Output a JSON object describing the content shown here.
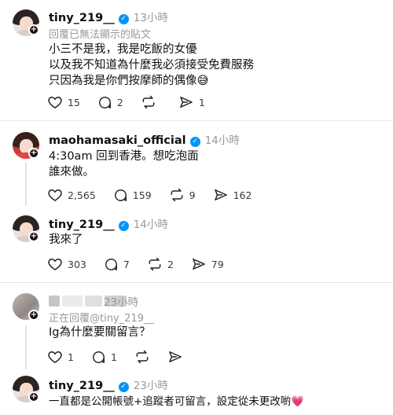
{
  "posts": [
    {
      "username": "tiny_219__",
      "verified": true,
      "time": "13小時",
      "subtext": "回覆已無法顯示的貼文",
      "text": "小三不是我，我是吃飯的女優\n以及我不知道為什麼我必須接受免費服務\n只因為我是你們按摩師的偶像😅",
      "likes": "15",
      "comments": "2",
      "reposts": "",
      "shares": "1"
    },
    {
      "username": "maohamasaki_official",
      "verified": true,
      "time": "14小時",
      "text": "4:30am 回到香港。想吃泡面\n誰來做。",
      "likes": "2,565",
      "comments": "159",
      "reposts": "9",
      "shares": "162"
    },
    {
      "username": "tiny_219__",
      "verified": true,
      "time": "14小時",
      "text": "我來了",
      "likes": "303",
      "comments": "7",
      "reposts": "2",
      "shares": "79"
    },
    {
      "username": "",
      "verified": false,
      "time": "23小時",
      "subtext": "正在回覆@tiny_219__",
      "text": "Ig為什麼要關留言？",
      "likes": "1",
      "comments": "1",
      "reposts": "",
      "shares": ""
    },
    {
      "username": "tiny_219__",
      "verified": true,
      "time": "23小時",
      "text": "一直都是公開帳號+追蹤者可留言，設定從未更改喲💗"
    }
  ],
  "icons": {
    "like": "heart-icon",
    "comment": "comment-icon",
    "repost": "repost-icon",
    "share": "send-icon",
    "follow": "plus-icon",
    "verified": "verified-check-icon"
  },
  "colors": {
    "text": "#101010",
    "muted": "#999999",
    "verified": "#0095f6",
    "divider": "#e6e6e6"
  }
}
